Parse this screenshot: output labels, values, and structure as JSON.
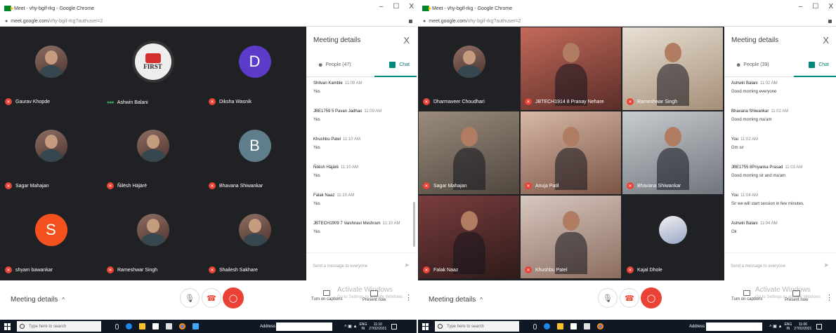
{
  "colors": {
    "meet_bg": "#202124",
    "mic_off": "#ea4335",
    "chat_accent": "#00897b",
    "end_call": "#ea4335",
    "taskbar": "#101826"
  },
  "left": {
    "title": "Meet - vhy-bgif-rkg - Google Chrome",
    "window_controls": [
      "–",
      "☐",
      "X"
    ],
    "url_host": "meet.google.com",
    "url_path": "/vhy-bgif-rkg?authuser=2",
    "participants": [
      {
        "name": "Gaurav Khopde",
        "avatar": "photo",
        "mic": "off"
      },
      {
        "name": "Ashwin Balani",
        "avatar": "first-logo",
        "mic": "speaking"
      },
      {
        "name": "Diksha Wasnik",
        "avatar": "letter",
        "letter": "D",
        "color": "#5c3bc9",
        "mic": "off"
      },
      {
        "name": "Sagar Mahajan",
        "avatar": "photo",
        "mic": "off"
      },
      {
        "name": "Ñilësh Häjärë",
        "avatar": "photo",
        "mic": "off"
      },
      {
        "name": "Bhavana Shiwankar",
        "avatar": "letter",
        "letter": "B",
        "color": "#607d8b",
        "mic": "off"
      },
      {
        "name": "shyam bawankar",
        "avatar": "letter",
        "letter": "S",
        "color": "#f4511e",
        "mic": "off"
      },
      {
        "name": "Rameshwar Singh",
        "avatar": "photo",
        "mic": "off"
      },
      {
        "name": "Shailesh Sakhare",
        "avatar": "photo",
        "mic": "off"
      }
    ],
    "logo_text": "FIRST",
    "panel": {
      "title": "Meeting details",
      "close": "X",
      "people_tab": "People (47)",
      "chat_tab": "Chat",
      "messages": [
        {
          "sender": "Shilvan Kamble",
          "time": "11:09 AM",
          "text": "Yes"
        },
        {
          "sender": "JBE1759 5 Pavan Jadhao",
          "time": "11:09 AM",
          "text": "Yes"
        },
        {
          "sender": "Khushbu Patel",
          "time": "11:10 AM",
          "text": "Yes"
        },
        {
          "sender": "Ñilësh Häjärë",
          "time": "11:10 AM",
          "text": "Yes"
        },
        {
          "sender": "Falak Naaz",
          "time": "11:10 AM",
          "text": "Yes"
        },
        {
          "sender": "JBTECH1909 7 Vaishnavi Meshram",
          "time": "11:10 AM",
          "text": "Yes"
        }
      ],
      "send_placeholder": "Send a message to everyone",
      "send_icon": "➤"
    },
    "bottom": {
      "details": "Meeting details",
      "chevron": "^",
      "captions": "Turn on captions",
      "present": "Present now",
      "more": "⋮",
      "activate_title": "Activate Windows",
      "activate_sub": "Go to Settings to activate Windows."
    },
    "taskbar": {
      "search": "Type here to search",
      "address": "Address",
      "lang_1": "ENG",
      "lang_2": "IN",
      "time": "11:10",
      "date": "27/02/2021"
    }
  },
  "right": {
    "title": "Meet - vhy-bgif-rkg - Google Chrome",
    "window_controls": [
      "–",
      "☐",
      "X"
    ],
    "url_host": "meet.google.com",
    "url_path": "/vhy-bgif-rkg?authuser=2",
    "participants": [
      {
        "name": "Dharmaveer Choudhari",
        "video": "avatar",
        "mic": "off"
      },
      {
        "name": "JBTECH1914 8 Pranay Nehare",
        "video": "v2",
        "mic": "off"
      },
      {
        "name": "Rameshwar Singh",
        "video": "v3",
        "mic": "off"
      },
      {
        "name": "Sagar Mahajan",
        "video": "v4",
        "mic": "off"
      },
      {
        "name": "Anuja Patil",
        "video": "v5",
        "mic": "off"
      },
      {
        "name": "Bhavana Shiwankar",
        "video": "v6",
        "mic": "off"
      },
      {
        "name": "Falak Naaz",
        "video": "v7",
        "mic": "off"
      },
      {
        "name": "Khushbu Patel",
        "video": "v8",
        "mic": "off"
      },
      {
        "name": "Kajal Dhole",
        "video": "small",
        "mic": "off"
      }
    ],
    "panel": {
      "title": "Meeting details",
      "close": "X",
      "people_tab": "People (39)",
      "chat_tab": "Chat",
      "messages": [
        {
          "sender": "Ashwin Balani",
          "time": "11:02 AM",
          "text": "Good morning everyone"
        },
        {
          "sender": "Bhavana Shiwankar",
          "time": "11:02 AM",
          "text": "Good morning ma'am"
        },
        {
          "sender": "You",
          "time": "11:02 AM",
          "text": "Gm sir"
        },
        {
          "sender": "JBE1755 8Priyanka Prasad",
          "time": "11:03 AM",
          "text": "Good morning sir and ma'am"
        },
        {
          "sender": "You",
          "time": "11:04 AM",
          "text": "Sir we will start session in few minutes."
        },
        {
          "sender": "Ashwin Balani",
          "time": "11:04 AM",
          "text": "Ok"
        }
      ],
      "send_placeholder": "Send a message to everyone",
      "send_icon": "➤"
    },
    "bottom": {
      "details": "Meeting details",
      "chevron": "^",
      "captions": "Turn on captions",
      "present": "Present now",
      "more": "⋮",
      "activate_title": "Activate Windows",
      "activate_sub": "Go to Settings to activate Windows."
    },
    "taskbar": {
      "search": "Type here to search",
      "address": "Address",
      "lang_1": "ENG",
      "lang_2": "IN",
      "time": "11:06",
      "date": "27/02/2021"
    }
  }
}
